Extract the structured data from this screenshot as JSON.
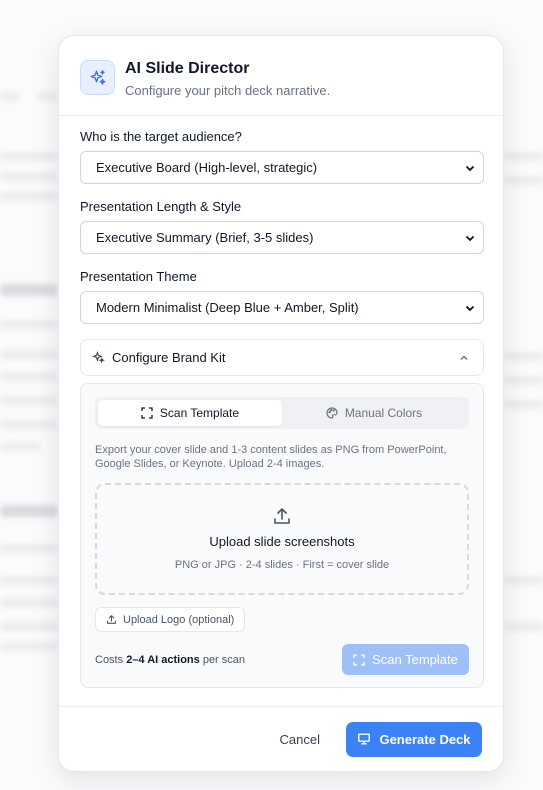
{
  "modal": {
    "title": "AI Slide Director",
    "subtitle": "Configure your pitch deck narrative.",
    "icon": "sparkles-icon"
  },
  "fields": [
    {
      "label": "Who is the target audience?",
      "value": "Executive Board (High-level, strategic)"
    },
    {
      "label": "Presentation Length & Style",
      "value": "Executive Summary (Brief, 3-5 slides)"
    },
    {
      "label": "Presentation Theme",
      "value": "Modern Minimalist (Deep Blue + Amber, Split)"
    }
  ],
  "brand_kit": {
    "toggle_label": "Configure Brand Kit",
    "tabs": [
      {
        "label": "Scan Template",
        "icon": "scan-icon",
        "active": true
      },
      {
        "label": "Manual Colors",
        "icon": "palette-icon",
        "active": false
      }
    ],
    "help_text": "Export your cover slide and 1-3 content slides as PNG from PowerPoint, Google Slides, or Keynote. Upload 2-4 images.",
    "drop_title": "Upload slide screenshots",
    "drop_sub": "PNG or JPG · 2-4 slides · First = cover slide",
    "logo_button": "Upload Logo (optional)",
    "cost_prefix": "Costs ",
    "cost_bold": "2–4 AI actions",
    "cost_suffix": " per scan",
    "scan_button": "Scan Template"
  },
  "footer": {
    "cancel": "Cancel",
    "generate": "Generate Deck"
  },
  "colors": {
    "accent": "#3b82f6",
    "accent_disabled": "#9fc0f7"
  }
}
